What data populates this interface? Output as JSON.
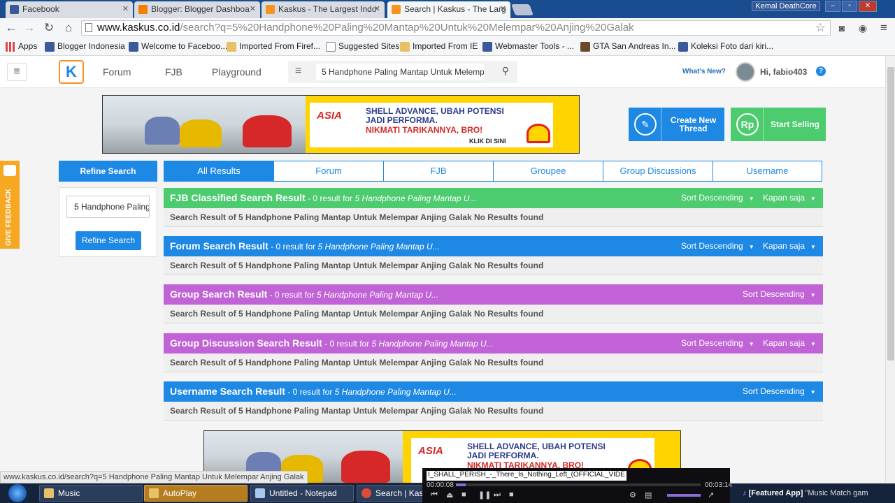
{
  "browser": {
    "tabs": [
      {
        "title": "Facebook",
        "favicon_color": "#3b5998"
      },
      {
        "title": "Blogger: Blogger Dashboa",
        "favicon_color": "#f57d00"
      },
      {
        "title": "Kaskus - The Largest Indo",
        "favicon_color": "#f7931e"
      },
      {
        "title": "Search | Kaskus - The Larg",
        "favicon_color": "#f7931e"
      }
    ],
    "window_user": "Kemal DeathCore",
    "url_host": "www.kaskus.co.id",
    "url_path": "/search?q=5%20Handphone%20Paling%20Mantap%20Untuk%20Melempar%20Anjing%20Galak",
    "bookmarks": [
      {
        "label": "Apps",
        "icon": "apps-grid-icon",
        "color": "#d44"
      },
      {
        "label": "Blogger Indonesia",
        "icon": "facebook-icon",
        "color": "#3b5998"
      },
      {
        "label": "Welcome to Faceboo...",
        "icon": "facebook-icon",
        "color": "#3b5998"
      },
      {
        "label": "Imported From Firef...",
        "icon": "folder-icon",
        "color": "#e8c068"
      },
      {
        "label": "Suggested Sites",
        "icon": "page-icon",
        "color": "#ffffff"
      },
      {
        "label": "Imported From IE",
        "icon": "folder-icon",
        "color": "#e8c068"
      },
      {
        "label": "Webmaster Tools - ...",
        "icon": "facebook-icon",
        "color": "#3b5998"
      },
      {
        "label": "GTA San Andreas In...",
        "icon": "gta-icon",
        "color": "#6b4a2a"
      },
      {
        "label": "Koleksi Foto dari kiri...",
        "icon": "facebook-icon",
        "color": "#3b5998"
      }
    ]
  },
  "header": {
    "logo_glyph": "K",
    "nav": [
      "Forum",
      "FJB",
      "Playground"
    ],
    "search_value": "5 Handphone Paling Mantap Untuk Melempar Anjing Galak",
    "whats_new": "What's New?",
    "greeting": "Hi, fabio403",
    "help": "?"
  },
  "banner": {
    "logo": "ASIA",
    "line1": "SHELL ADVANCE, UBAH POTENSI",
    "line2": "JADI PERFORMA.",
    "line3": "NIKMATI TARIKANNYA, BRO!",
    "cta": "KLIK DI SINI"
  },
  "actions": {
    "create_thread": "Create New Thread",
    "start_selling": "Start Selling",
    "sell_icon": "Rp"
  },
  "feedback": "GIVE FEEDBACK",
  "refine": {
    "title": "Refine Search",
    "input_value": "5 Handphone Paling Mantap Untuk Melempar Anjing Galak",
    "button": "Refine Search"
  },
  "filter_tabs": [
    "All Results",
    "Forum",
    "FJB",
    "Groupee",
    "Group Discussions",
    "Username"
  ],
  "results": [
    {
      "title": "FJB Classified Search Result",
      "count": " - 0 result for ",
      "query": "5 Handphone Paling Mantap U...",
      "sort": "Sort Descending",
      "time": "Kapan saja",
      "color": "#4ccb6f",
      "body": "Search Result of 5 Handphone Paling Mantap Untuk Melempar Anjing Galak No Results found"
    },
    {
      "title": "Forum Search Result",
      "count": " - 0 result for ",
      "query": "5 Handphone Paling Mantap U...",
      "sort": "Sort Descending",
      "time": "Kapan saja",
      "color": "#1e88e5",
      "body": "Search Result of 5 Handphone Paling Mantap Untuk Melempar Anjing Galak No Results found"
    },
    {
      "title": "Group Search Result",
      "count": " - 0 result for ",
      "query": "5 Handphone Paling Mantap U...",
      "sort": "Sort Descending",
      "time": "",
      "color": "#c163d6",
      "body": "Search Result of 5 Handphone Paling Mantap Untuk Melempar Anjing Galak No Results found"
    },
    {
      "title": "Group Discussion Search Result",
      "count": " - 0 result for ",
      "query": "5 Handphone Paling Mantap U...",
      "sort": "Sort Descending",
      "time": "Kapan saja",
      "color": "#c163d6",
      "body": "Search Result of 5 Handphone Paling Mantap Untuk Melempar Anjing Galak No Results found"
    },
    {
      "title": "Username Search Result",
      "count": " - 0 result for ",
      "query": "5 Handphone Paling Mantap U...",
      "sort": "Sort Descending",
      "time": "",
      "color": "#1e88e5",
      "body": "Search Result of 5 Handphone Paling Mantap Untuk Melempar Anjing Galak No Results found"
    }
  ],
  "statusbar_url": "www.kaskus.co.id/search?q=5 Handphone Paling Mantap Untuk Melempar Anjing Galak",
  "taskbar": {
    "items": [
      {
        "label": "Music",
        "color": "#e8c068"
      },
      {
        "label": "AutoPlay",
        "color": "#e8c068"
      },
      {
        "label": "Untitled - Notepad",
        "color": "#a7c7ea"
      },
      {
        "label": "Search | Kaskus - ...",
        "color": "#dd4b39"
      }
    ],
    "media_title": "I_SHALL_PERISH_-_There_Is_Nothing_Left_(OFFICIAL_VIDE",
    "media_elapsed": "00:00:08",
    "media_total": "00:03:14",
    "media_progress": 0.04,
    "featured_label": "[Featured App]",
    "featured_text": " \"Music Match gam"
  }
}
